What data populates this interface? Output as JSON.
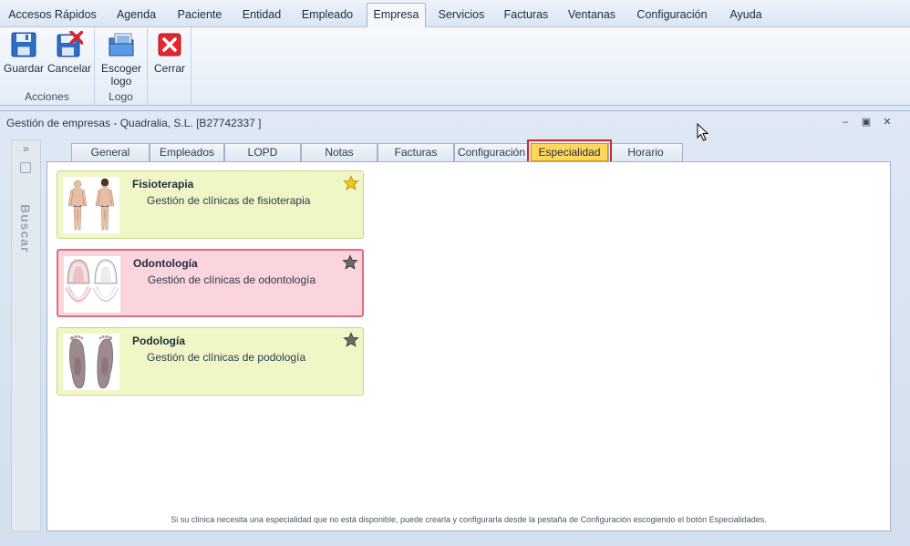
{
  "menu": {
    "items": [
      {
        "label": "Accesos Rápidos"
      },
      {
        "label": "Agenda"
      },
      {
        "label": "Paciente"
      },
      {
        "label": "Entidad"
      },
      {
        "label": "Empleado"
      },
      {
        "label": "Empresa",
        "active": true
      },
      {
        "label": "Servicios"
      },
      {
        "label": "Facturas"
      },
      {
        "label": "Ventanas"
      },
      {
        "label": "Configuración"
      },
      {
        "label": "Ayuda"
      }
    ]
  },
  "ribbon": {
    "groups": [
      {
        "label": "Acciones",
        "buttons": [
          {
            "label": "Guardar",
            "icon": "save-icon"
          },
          {
            "label": "Cancelar",
            "icon": "cancel-save-icon"
          }
        ]
      },
      {
        "label": "Logo",
        "buttons": [
          {
            "label": "Escoger logo",
            "line1": "Escoger",
            "line2": "logo",
            "icon": "choose-logo-icon"
          }
        ]
      },
      {
        "label": "",
        "buttons": [
          {
            "label": "Cerrar",
            "icon": "close-red-icon"
          }
        ]
      }
    ]
  },
  "window": {
    "title": "Gestión de empresas - Quadralia, S.L.  [B27742337 ]",
    "side_panel_label": "Buscar",
    "side_chevron": "»",
    "controls": {
      "minimize": "‒",
      "restore": "▣",
      "close": "✕"
    }
  },
  "tabs": [
    {
      "label": "General"
    },
    {
      "label": "Empleados"
    },
    {
      "label": "LOPD"
    },
    {
      "label": "Notas"
    },
    {
      "label": "Facturas"
    },
    {
      "label": "Configuración"
    },
    {
      "label": "Especialidad",
      "active": true
    },
    {
      "label": "Horario"
    }
  ],
  "specialties": [
    {
      "title": "Fisioterapia",
      "description": "Gestión de clínicas de fisioterapia",
      "favorite": true,
      "color": "green",
      "icon": "body-figure-icon"
    },
    {
      "title": "Odontología",
      "description": "Gestión de clínicas de odontología",
      "favorite": false,
      "color": "pink",
      "icon": "teeth-icon"
    },
    {
      "title": "Podología",
      "description": "Gestión de clínicas de podología",
      "favorite": false,
      "color": "green",
      "icon": "feet-icon"
    }
  ],
  "footnote": "Si su clínica necesita una especialidad que no está disponible, puede crearla y configurarla desde la pestaña de Configuración escogiendo el botón Especialidades.",
  "colors": {
    "active_tab": "#ffd75c",
    "highlight_border": "#d0252b",
    "card_green": "#f0f7c6",
    "card_pink": "#fbd5dd",
    "favorite_star": "#f5c518"
  }
}
